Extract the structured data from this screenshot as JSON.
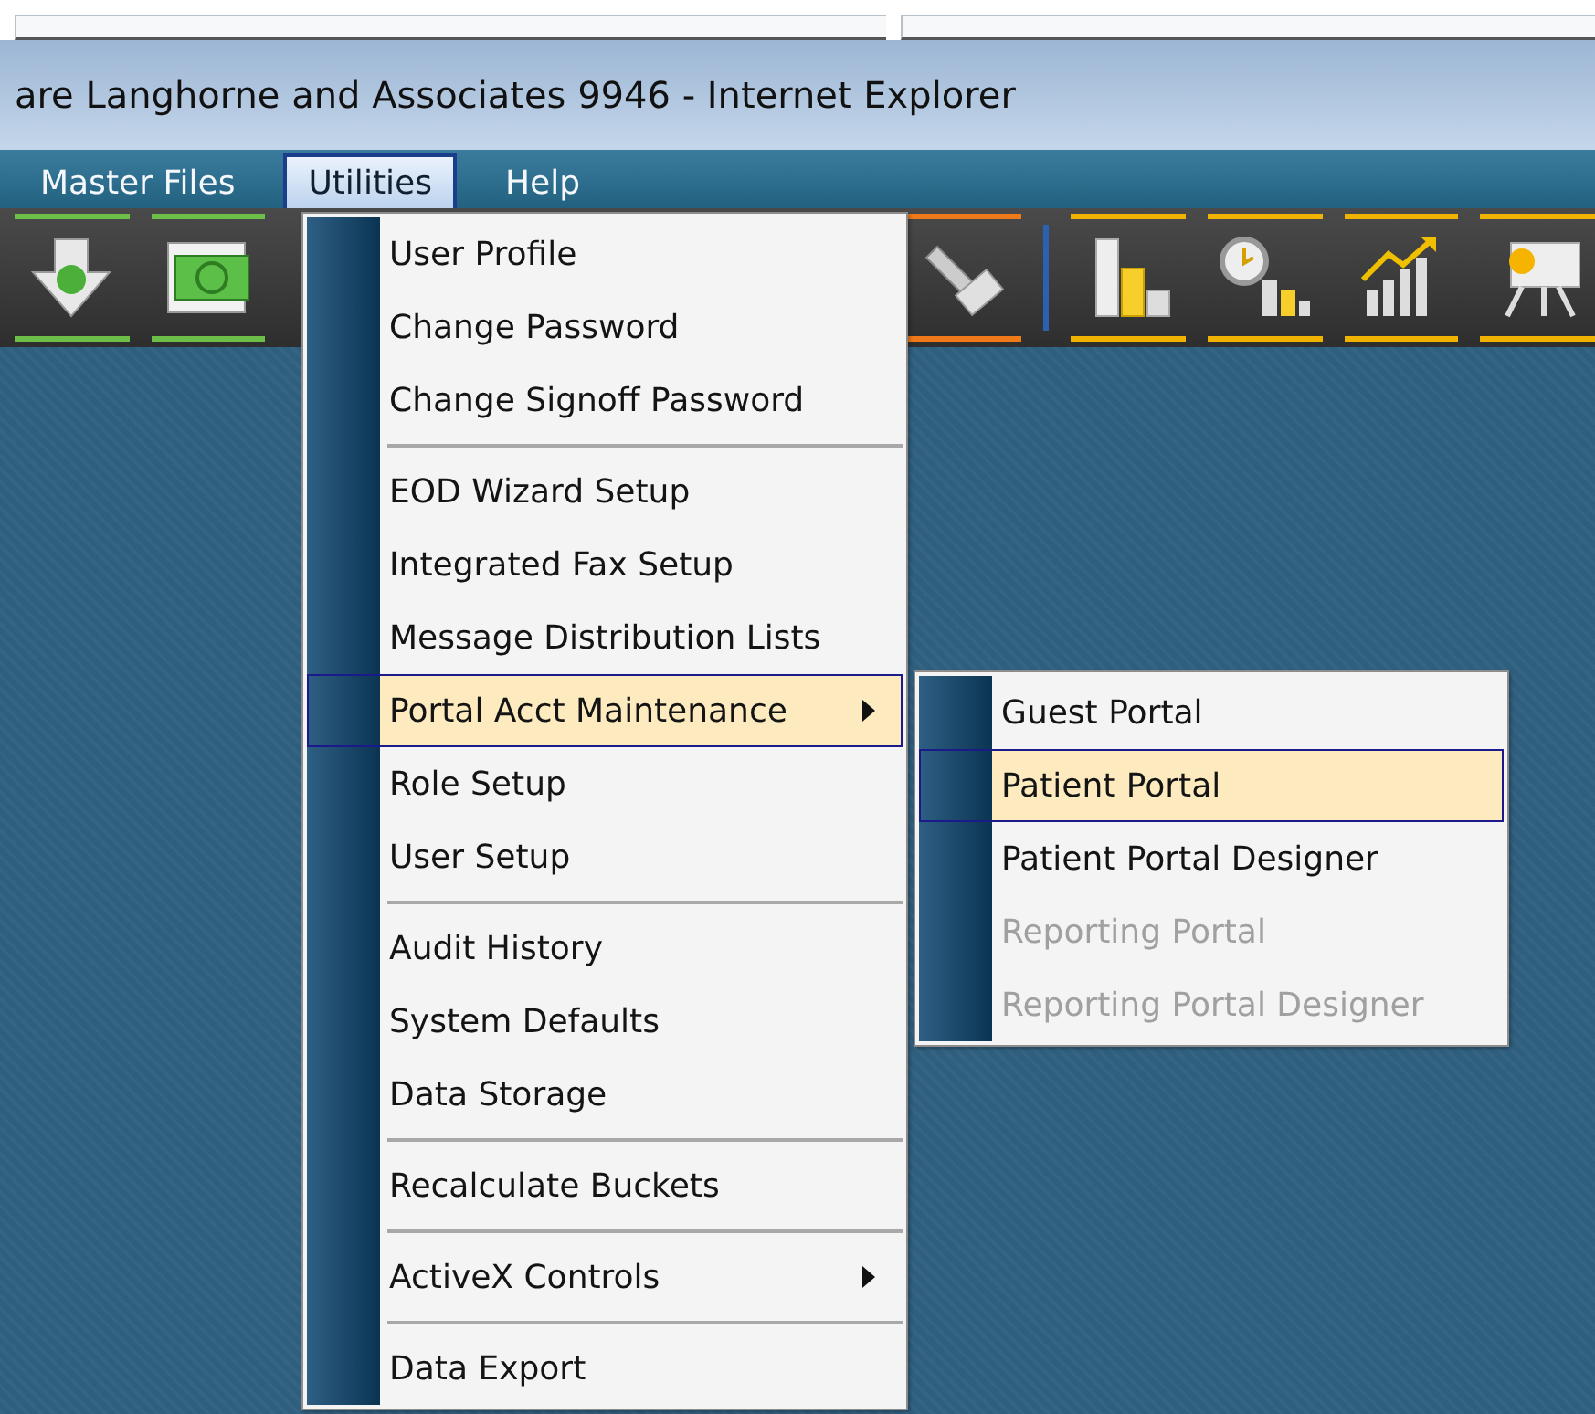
{
  "window": {
    "title": "are Langhorne and Associates 9946 - Internet Explorer"
  },
  "menu_bar": [
    {
      "label": "Master Files",
      "selected": false
    },
    {
      "label": "Utilities",
      "selected": true
    },
    {
      "label": "Help",
      "selected": false
    }
  ],
  "toolbar": [
    {
      "kind": "money-down",
      "color": "#6cc04a"
    },
    {
      "kind": "bill",
      "color": "#6cc04a"
    },
    {
      "kind": "due",
      "color": "#f07a1a"
    },
    {
      "kind": "separator"
    },
    {
      "kind": "bar-chart",
      "color": "#f0b400"
    },
    {
      "kind": "clock-chart",
      "color": "#f0b400"
    },
    {
      "kind": "growth-chart",
      "color": "#f0b400"
    },
    {
      "kind": "presentation",
      "color": "#f0b400"
    }
  ],
  "utilities_menu": [
    {
      "kind": "item",
      "label": "User Profile",
      "selected": false,
      "has_submenu": false
    },
    {
      "kind": "item",
      "label": "Change Password",
      "selected": false,
      "has_submenu": false
    },
    {
      "kind": "item",
      "label": "Change Signoff Password",
      "selected": false,
      "has_submenu": false
    },
    {
      "kind": "separator"
    },
    {
      "kind": "item",
      "label": "EOD Wizard Setup",
      "selected": false,
      "has_submenu": false
    },
    {
      "kind": "item",
      "label": "Integrated Fax Setup",
      "selected": false,
      "has_submenu": false
    },
    {
      "kind": "item",
      "label": "Message Distribution Lists",
      "selected": false,
      "has_submenu": false
    },
    {
      "kind": "item",
      "label": "Portal Acct Maintenance",
      "selected": true,
      "has_submenu": true
    },
    {
      "kind": "item",
      "label": "Role Setup",
      "selected": false,
      "has_submenu": false
    },
    {
      "kind": "item",
      "label": "User Setup",
      "selected": false,
      "has_submenu": false
    },
    {
      "kind": "separator"
    },
    {
      "kind": "item",
      "label": "Audit History",
      "selected": false,
      "has_submenu": false
    },
    {
      "kind": "item",
      "label": "System Defaults",
      "selected": false,
      "has_submenu": false
    },
    {
      "kind": "item",
      "label": "Data Storage",
      "selected": false,
      "has_submenu": false
    },
    {
      "kind": "separator"
    },
    {
      "kind": "item",
      "label": "Recalculate Buckets",
      "selected": false,
      "has_submenu": false
    },
    {
      "kind": "separator"
    },
    {
      "kind": "item",
      "label": "ActiveX Controls",
      "selected": false,
      "has_submenu": true
    },
    {
      "kind": "separator"
    },
    {
      "kind": "item",
      "label": "Data Export",
      "selected": false,
      "has_submenu": false
    }
  ],
  "portal_submenu": [
    {
      "label": "Guest Portal",
      "selected": false,
      "disabled": false
    },
    {
      "label": "Patient Portal",
      "selected": true,
      "disabled": false
    },
    {
      "label": "Patient Portal Designer",
      "selected": false,
      "disabled": false
    },
    {
      "label": "Reporting Portal",
      "selected": false,
      "disabled": true
    },
    {
      "label": "Reporting Portal Designer",
      "selected": false,
      "disabled": true
    }
  ]
}
